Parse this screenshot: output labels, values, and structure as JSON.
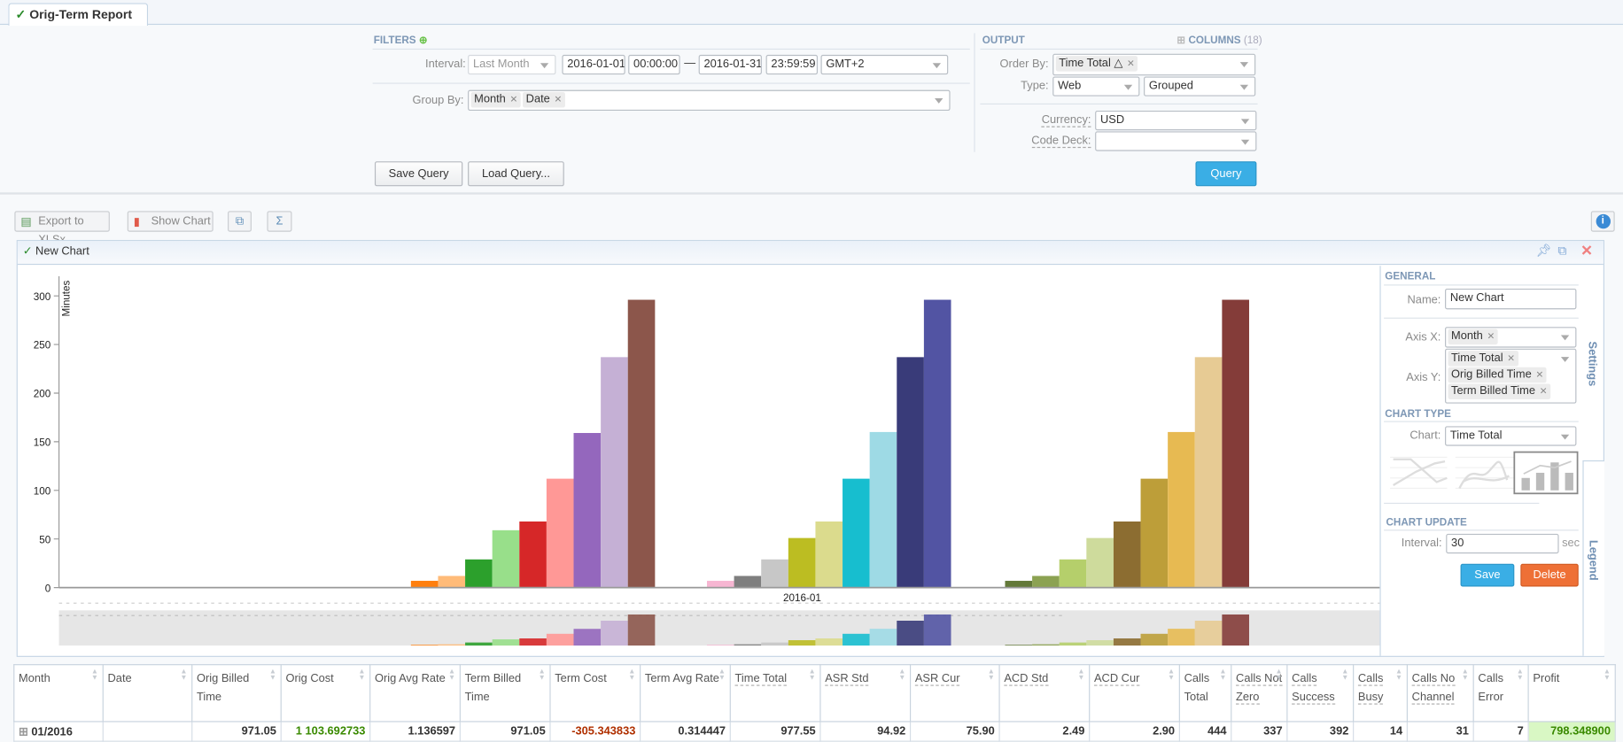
{
  "tab": {
    "title": "Orig-Term Report"
  },
  "filters": {
    "title": "FILTERS",
    "interval_label": "Interval:",
    "interval_value": "Last Month",
    "date_from": "2016-01-01",
    "time_from": "00:00:00",
    "dash": "—",
    "date_to": "2016-01-31",
    "time_to": "23:59:59",
    "timezone": "GMT+2",
    "group_by_label": "Group By:",
    "group_by": [
      "Month",
      "Date"
    ],
    "save_query": "Save Query",
    "load_query": "Load Query..."
  },
  "output": {
    "title": "OUTPUT",
    "columns_label": "COLUMNS",
    "columns_count": "(18)",
    "order_by_label": "Order By:",
    "order_by": "Time Total △",
    "type_label": "Type:",
    "type_value": "Web",
    "type_mode": "Grouped",
    "currency_label": "Currency:",
    "currency": "USD",
    "code_deck_label": "Code Deck:",
    "code_deck": "",
    "query": "Query"
  },
  "toolbar": {
    "export": "Export to XLSx",
    "show_chart": "Show Chart"
  },
  "chart_panel": {
    "title": "New Chart",
    "settings": {
      "general": "GENERAL",
      "name_label": "Name:",
      "name": "New Chart",
      "axis_x_label": "Axis X:",
      "axis_x": [
        "Month"
      ],
      "axis_y_label": "Axis Y:",
      "axis_y": [
        "Time Total",
        "Orig Billed Time",
        "Term Billed Time"
      ],
      "chart_type": "CHART TYPE",
      "chart_label": "Chart:",
      "chart_value": "Time Total",
      "chart_update": "CHART UPDATE",
      "interval_label": "Interval:",
      "interval": "30",
      "interval_unit": "sec",
      "save": "Save",
      "delete": "Delete"
    },
    "side_tabs": {
      "settings": "Settings",
      "legend": "Legend"
    }
  },
  "chart_data": {
    "type": "bar",
    "ylabel": "Minutes",
    "categories": [
      "2016-01"
    ],
    "ylim": [
      0,
      300
    ],
    "yticks": [
      0,
      50,
      100,
      150,
      200,
      250,
      300
    ],
    "groups": [
      {
        "values": [
          7,
          12,
          29,
          59,
          68,
          112,
          159,
          237,
          296
        ],
        "colors": [
          "#ff7f0e",
          "#ffbb78",
          "#2ca02c",
          "#98df8a",
          "#d62728",
          "#ff9896",
          "#9467bd",
          "#c5b0d5",
          "#8c564b"
        ]
      },
      {
        "values": [
          7,
          12,
          29,
          51,
          68,
          112,
          160,
          237,
          296
        ],
        "colors": [
          "#f7b6d2",
          "#7f7f7f",
          "#c7c7c7",
          "#bcbd22",
          "#dbdb8d",
          "#17becf",
          "#9edae5",
          "#393b79",
          "#5254a3"
        ]
      },
      {
        "values": [
          7,
          12,
          29,
          51,
          68,
          112,
          160,
          237,
          296
        ],
        "colors": [
          "#637939",
          "#8ca252",
          "#b5cf6b",
          "#cedb9c",
          "#8c6d31",
          "#bd9e39",
          "#e7ba52",
          "#e7cb94",
          "#843c39"
        ]
      }
    ],
    "grid": false
  },
  "table": {
    "columns": [
      "Month",
      "Date",
      "Orig Billed Time",
      "Orig Cost",
      "Orig Avg Rate",
      "Term Billed Time",
      "Term Cost",
      "Term Avg Rate",
      "Time Total",
      "ASR Std",
      "ASR Cur",
      "ACD Std",
      "ACD Cur",
      "Calls Total",
      "Calls Not Zero",
      "Calls Success",
      "Calls Busy",
      "Calls No Channel",
      "Calls Error",
      "Profit"
    ],
    "rows": [
      [
        "01/2016",
        "",
        "971.05",
        "1 103.692733",
        "1.136597",
        "971.05",
        "-305.343833",
        "0.314447",
        "977.55",
        "94.92",
        "75.90",
        "2.49",
        "2.90",
        "444",
        "337",
        "392",
        "14",
        "31",
        "7",
        "798.348900"
      ]
    ]
  },
  "colors": {
    "accent": "#3aaee5",
    "delete": "#ee7036",
    "positive": "#3a8a00",
    "negative": "#b03000",
    "profit_bg": "#d9f7c4"
  }
}
